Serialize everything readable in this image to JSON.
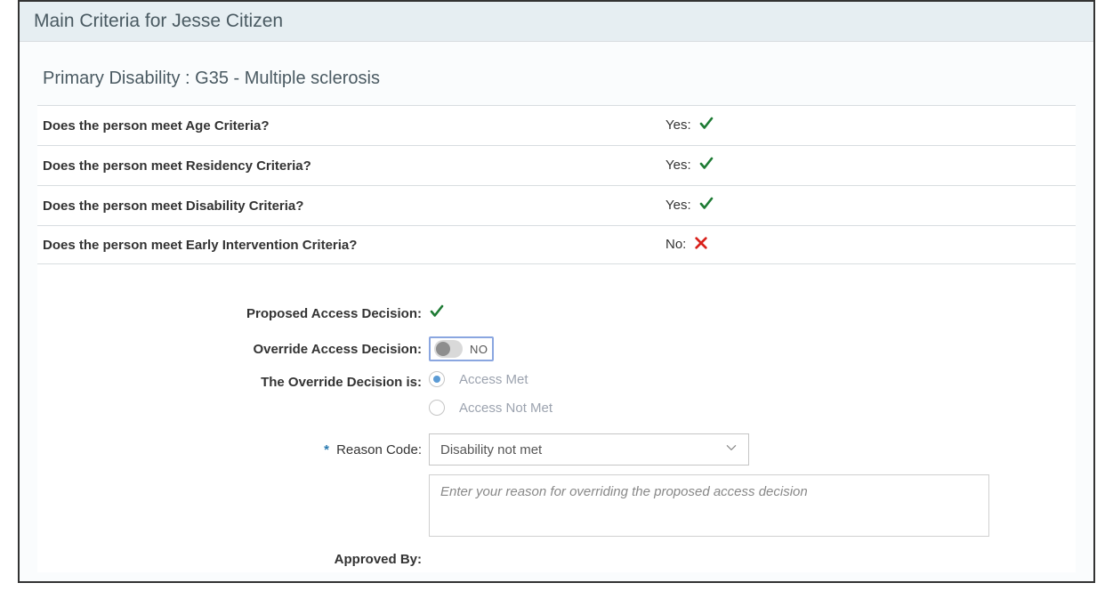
{
  "header": {
    "title": "Main Criteria for Jesse Citizen"
  },
  "primary_disability": {
    "label": "Primary Disability : G35 - Multiple sclerosis"
  },
  "criteria": [
    {
      "question": "Does the person meet Age Criteria?",
      "answer_prefix": "Yes:",
      "status": "yes"
    },
    {
      "question": "Does the person meet Residency Criteria?",
      "answer_prefix": "Yes:",
      "status": "yes"
    },
    {
      "question": "Does the person meet Disability Criteria?",
      "answer_prefix": "Yes:",
      "status": "yes"
    },
    {
      "question": "Does the person meet Early Intervention Criteria?",
      "answer_prefix": "No:",
      "status": "no"
    }
  ],
  "decision": {
    "proposed_label": "Proposed Access Decision:",
    "proposed_status": "yes",
    "override_label": "Override Access Decision:",
    "override_toggle": "NO",
    "override_decision_label": "The Override Decision is:",
    "radio_options": {
      "met": "Access Met",
      "not_met": "Access Not Met",
      "selected": "met"
    },
    "reason_code_label": "Reason Code:",
    "reason_code_value": "Disability not met",
    "reason_text_placeholder": "Enter your reason for overriding the proposed access decision",
    "approved_by_label": "Approved By:"
  }
}
